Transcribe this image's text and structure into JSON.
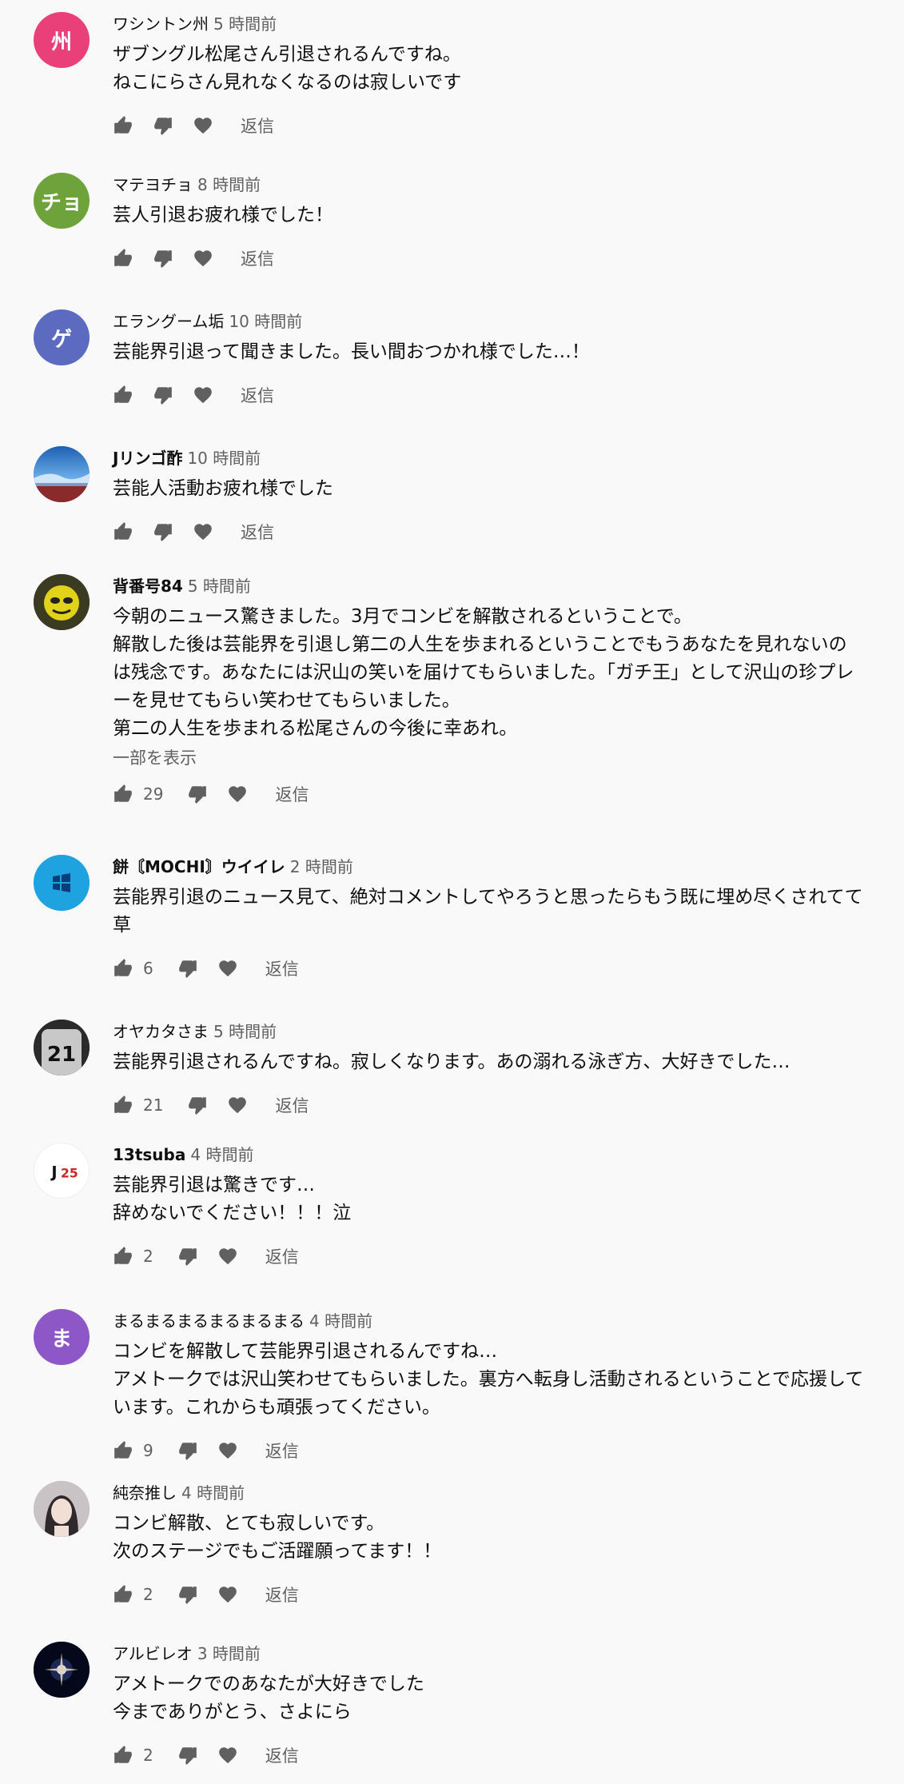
{
  "comments": [
    {
      "author": "ワシントン州",
      "time": "5 時間前",
      "text": "ザブングル松尾さん引退されるんですね。\nねこにらさん見れなくなるのは寂しいです",
      "likes": "",
      "show_more": "",
      "reply": "返信",
      "avatar_char": "州",
      "avatar_color": "#e9407a"
    },
    {
      "author": "マテヨチョ",
      "time": "8 時間前",
      "text": "芸人引退お疲れ様でした！",
      "likes": "",
      "show_more": "",
      "reply": "返信",
      "avatar_char": "チョ",
      "avatar_color": "#6ea33b"
    },
    {
      "author": "エラングーム垢",
      "time": "10 時間前",
      "text": "芸能界引退って聞きました。長い間おつかれ様でした…！",
      "likes": "",
      "show_more": "",
      "reply": "返信",
      "avatar_char": "ゲ",
      "avatar_color": "#5c6bc0"
    },
    {
      "author": "Jリンゴ酢",
      "time": "10 時間前",
      "text": "芸能人活動お疲れ様でした",
      "likes": "",
      "show_more": "",
      "reply": "返信",
      "avatar_char": "",
      "avatar_color": "#3a78c7"
    },
    {
      "author": "背番号84",
      "time": "5 時間前",
      "text": "今朝のニュース驚きました。3月でコンビを解散されるということで。\n解散した後は芸能界を引退し第二の人生を歩まれるということでもうあなたを見れないのは残念です。あなたには沢山の笑いを届けてもらいました。「ガチ王」として沢山の珍プレーを見せてもらい笑わせてもらいました。\n第二の人生を歩まれる松尾さんの今後に幸あれ。",
      "likes": "29",
      "show_more": "一部を表示",
      "reply": "返信",
      "avatar_char": "",
      "avatar_color": "#4a4a2a"
    },
    {
      "author": "餅〘MOCHI〙ウイイレ",
      "time": "2 時間前",
      "text": "芸能界引退のニュース見て、絶対コメントしてやろうと思ったらもう既に埋め尽くされてて草",
      "likes": "6",
      "show_more": "",
      "reply": "返信",
      "avatar_char": "",
      "avatar_color": "#1fa3e0"
    },
    {
      "author": "オヤカタさま",
      "time": "5 時間前",
      "text": "芸能界引退されるんですね。寂しくなります。あの溺れる泳ぎ方、大好きでした…",
      "likes": "21",
      "show_more": "",
      "reply": "返信",
      "avatar_char": "",
      "avatar_color": "#2a2a2a"
    },
    {
      "author": "13tsuba",
      "time": "4 時間前",
      "text": "芸能界引退は驚きです…\n辞めないでください！！！泣",
      "likes": "2",
      "show_more": "",
      "reply": "返信",
      "avatar_char": "",
      "avatar_color": "#ffffff"
    },
    {
      "author": "まるまるまるまるまるまる",
      "time": "4 時間前",
      "text": "コンビを解散して芸能界引退されるんですね…\nアメトークでは沢山笑わせてもらいました。裏方へ転身し活動されるということで応援しています。これからも頑張ってください。",
      "likes": "9",
      "show_more": "",
      "reply": "返信",
      "avatar_char": "ま",
      "avatar_color": "#8e57c7"
    },
    {
      "author": "純奈推し",
      "time": "4 時間前",
      "text": "コンビ解散、とても寂しいです。\n次のステージでもご活躍願ってます！！",
      "likes": "2",
      "show_more": "",
      "reply": "返信",
      "avatar_char": "",
      "avatar_color": "#b9b3b6"
    },
    {
      "author": "アルビレオ",
      "time": "3 時間前",
      "text": "アメトークでのあなたが大好きでした\n今までありがとう、さよにら",
      "likes": "2",
      "show_more": "",
      "reply": "返信",
      "avatar_char": "",
      "avatar_color": "#05081a"
    }
  ]
}
